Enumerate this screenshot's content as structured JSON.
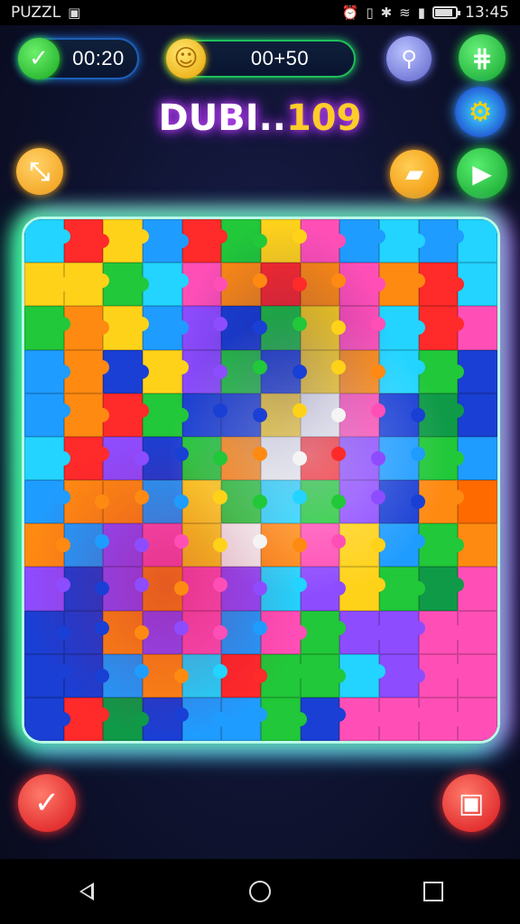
{
  "status_bar": {
    "app_label": "PUZZL",
    "time": "13:45",
    "battery_level": 0.85
  },
  "hud": {
    "timer": "00:20",
    "score": "00+50",
    "level_name": "DUBI..",
    "level_number": "109"
  },
  "buttons": {
    "check_top": "✓",
    "search": "⚲",
    "grid": "⋕",
    "settings": "⚙",
    "hint": "⤡",
    "shop": "▰",
    "play": "▶",
    "confirm": "✓",
    "delete": "▣"
  },
  "board": {
    "rows": 12,
    "cols": 12,
    "palette": [
      "#1f9cff",
      "#ff2a2a",
      "#ffd21a",
      "#ff8a12",
      "#21c839",
      "#ff4fb7",
      "#8e4cff",
      "#1a3fd4",
      "#22d4ff",
      "#f4f4f4",
      "#0f9a48",
      "#ff6a00"
    ],
    "tiles": [
      [
        8,
        1,
        2,
        0,
        1,
        4,
        2,
        5,
        0,
        8,
        0,
        8
      ],
      [
        2,
        2,
        4,
        8,
        5,
        3,
        1,
        3,
        5,
        3,
        1,
        8
      ],
      [
        4,
        3,
        2,
        0,
        6,
        7,
        4,
        2,
        5,
        8,
        1,
        5
      ],
      [
        0,
        3,
        7,
        2,
        6,
        4,
        7,
        2,
        3,
        8,
        4,
        7
      ],
      [
        0,
        3,
        1,
        4,
        7,
        7,
        2,
        9,
        5,
        7,
        10,
        7
      ],
      [
        8,
        1,
        6,
        7,
        4,
        3,
        9,
        1,
        6,
        0,
        4,
        0
      ],
      [
        0,
        3,
        3,
        0,
        2,
        4,
        8,
        4,
        6,
        7,
        3,
        11
      ],
      [
        3,
        0,
        6,
        5,
        2,
        9,
        3,
        5,
        2,
        0,
        4,
        3
      ],
      [
        6,
        7,
        6,
        3,
        5,
        6,
        8,
        6,
        2,
        4,
        10,
        5
      ],
      [
        7,
        7,
        3,
        6,
        5,
        0,
        5,
        4,
        6,
        6,
        5,
        5
      ],
      [
        7,
        7,
        0,
        3,
        8,
        1,
        4,
        4,
        8,
        6,
        5,
        5
      ],
      [
        7,
        1,
        10,
        7,
        0,
        0,
        4,
        7,
        5,
        5,
        5,
        5
      ]
    ]
  }
}
